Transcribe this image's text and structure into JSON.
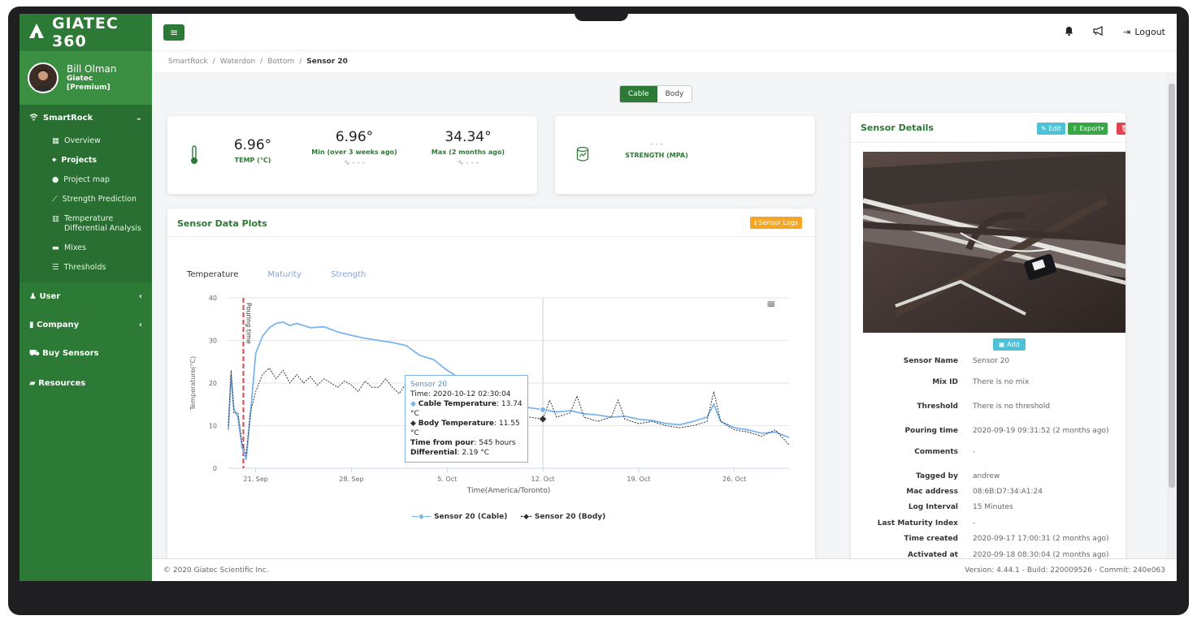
{
  "brand": {
    "name": "GIATEC 360"
  },
  "user": {
    "name": "Bill Olman",
    "company": "Giatec",
    "plan": "[Premium]"
  },
  "sidebar": {
    "group_title": "SmartRock",
    "items": [
      {
        "label": "Overview",
        "icon": "grid-icon"
      },
      {
        "label": "Projects",
        "icon": "sitemap-icon"
      },
      {
        "label": "Project map",
        "icon": "globe-icon"
      },
      {
        "label": "Strength Prediction",
        "icon": "line-chart-icon"
      },
      {
        "label": "Temperature Differential Analysis",
        "icon": "bar-chart-icon"
      },
      {
        "label": "Mixes",
        "icon": "truck-icon"
      },
      {
        "label": "Thresholds",
        "icon": "sliders-icon"
      }
    ],
    "links": [
      {
        "label": "User",
        "icon": "user-icon"
      },
      {
        "label": "Company",
        "icon": "building-icon"
      },
      {
        "label": "Buy Sensors",
        "icon": "cart-icon"
      },
      {
        "label": "Resources",
        "icon": "book-icon"
      }
    ]
  },
  "topbar": {
    "logout": "Logout"
  },
  "breadcrumb": [
    "SmartRock",
    "Waterdon",
    "Bottom",
    "Sensor 20"
  ],
  "toggle": {
    "cable": "Cable",
    "body": "Body"
  },
  "stats": {
    "temp": {
      "value": "6.96°",
      "label": "TEMP (°C)"
    },
    "min": {
      "value": "6.96°",
      "label": "Min (over 3 weeks ago)",
      "spark": "∿ - - -"
    },
    "max": {
      "value": "34.34°",
      "label": "Max (2 months ago)",
      "spark": "∿ - - -"
    },
    "strength": {
      "value": "- - -",
      "label": "STRENGTH (MPA)"
    }
  },
  "plots": {
    "title": "Sensor Data Plots",
    "logs_button": "Sensor Logs",
    "tabs": [
      "Temperature",
      "Maturity",
      "Strength"
    ],
    "pour_label": "Pouring time",
    "tooltip": {
      "title": "Sensor 20",
      "time_label": "Time",
      "time_value": "2020-10-12 02:30:04",
      "cable_label": "Cable Temperature",
      "cable_value": "13.74 °C",
      "body_label": "Body Temperature",
      "body_value": "11.55 °C",
      "pour_label": "Time from pour",
      "pour_value": "545 hours",
      "diff_label": "Differential",
      "diff_value": "2.19 °C"
    },
    "legend": {
      "cable": "Sensor 20 (Cable)",
      "body": "Sensor 20 (Body)"
    }
  },
  "chart_data": {
    "type": "line",
    "xlabel": "Time(America/Toronto)",
    "ylabel": "Temperature(°C)",
    "ylim": [
      0,
      40
    ],
    "yticks": [
      0,
      10,
      20,
      30,
      40
    ],
    "xticks": [
      "21. Sep",
      "28. Sep",
      "5. Oct",
      "12. Oct",
      "19. Oct",
      "26. Oct"
    ],
    "xtick_days": [
      2,
      9,
      16,
      23,
      30,
      37
    ],
    "xlim_days": [
      0,
      41
    ],
    "pour_day": 1.1,
    "crosshair_day": 23,
    "series": [
      {
        "name": "Sensor 20 (Cable)",
        "color": "#7cb5ec",
        "points": [
          [
            0,
            9
          ],
          [
            0.2,
            22
          ],
          [
            0.4,
            14
          ],
          [
            0.7,
            12
          ],
          [
            1,
            5
          ],
          [
            1.3,
            2
          ],
          [
            1.6,
            12
          ],
          [
            2,
            27
          ],
          [
            2.5,
            31
          ],
          [
            3,
            33
          ],
          [
            3.5,
            34
          ],
          [
            4,
            34.3
          ],
          [
            4.5,
            33.5
          ],
          [
            5,
            34
          ],
          [
            6,
            33
          ],
          [
            7,
            33.2
          ],
          [
            8,
            32
          ],
          [
            9,
            31.2
          ],
          [
            10,
            30.5
          ],
          [
            11,
            30
          ],
          [
            12,
            29.5
          ],
          [
            13,
            28.8
          ],
          [
            14,
            26.5
          ],
          [
            15,
            25.5
          ],
          [
            16,
            23
          ],
          [
            17,
            21
          ],
          [
            18,
            19.5
          ],
          [
            19,
            18
          ],
          [
            20,
            16.5
          ],
          [
            21,
            15
          ],
          [
            22,
            14.2
          ],
          [
            23,
            13.74
          ],
          [
            24,
            13.2
          ],
          [
            25,
            13.5
          ],
          [
            26,
            12.8
          ],
          [
            27,
            12.5
          ],
          [
            28,
            12
          ],
          [
            29,
            12.2
          ],
          [
            30,
            11.5
          ],
          [
            31,
            11.2
          ],
          [
            32,
            10.5
          ],
          [
            33,
            10.2
          ],
          [
            34,
            11
          ],
          [
            35,
            12
          ],
          [
            35.5,
            15
          ],
          [
            36,
            11
          ],
          [
            37,
            9.5
          ],
          [
            38,
            9
          ],
          [
            39,
            8.2
          ],
          [
            40,
            8.5
          ],
          [
            41,
            7.2
          ]
        ]
      },
      {
        "name": "Sensor 20 (Body)",
        "color": "#333333",
        "points": [
          [
            0,
            10
          ],
          [
            0.2,
            23
          ],
          [
            0.4,
            13
          ],
          [
            0.7,
            13
          ],
          [
            1,
            6
          ],
          [
            1.3,
            3
          ],
          [
            1.6,
            13
          ],
          [
            2,
            18
          ],
          [
            2.5,
            22
          ],
          [
            3,
            23.5
          ],
          [
            3.5,
            21
          ],
          [
            4,
            23
          ],
          [
            4.5,
            20
          ],
          [
            5,
            22
          ],
          [
            5.5,
            20
          ],
          [
            6,
            21.5
          ],
          [
            6.5,
            19.5
          ],
          [
            7,
            21
          ],
          [
            7.5,
            20
          ],
          [
            8,
            19
          ],
          [
            8.5,
            20.5
          ],
          [
            9,
            19.5
          ],
          [
            9.5,
            18
          ],
          [
            10,
            20.5
          ],
          [
            10.5,
            19
          ],
          [
            11,
            19
          ],
          [
            11.5,
            21
          ],
          [
            12,
            19
          ],
          [
            12.5,
            17.5
          ],
          [
            13,
            20
          ],
          [
            13.5,
            18
          ],
          [
            14,
            17
          ],
          [
            15,
            18.5
          ],
          [
            16,
            17
          ],
          [
            17,
            15.5
          ],
          [
            18,
            16
          ],
          [
            19,
            14
          ],
          [
            20,
            13.5
          ],
          [
            21,
            12.5
          ],
          [
            22,
            12
          ],
          [
            23,
            11.55
          ],
          [
            23.5,
            16
          ],
          [
            24,
            12
          ],
          [
            25,
            13
          ],
          [
            25.5,
            17
          ],
          [
            26,
            12
          ],
          [
            27,
            11
          ],
          [
            28,
            12
          ],
          [
            28.5,
            16
          ],
          [
            29,
            11.5
          ],
          [
            30,
            10.5
          ],
          [
            31,
            11
          ],
          [
            32,
            10
          ],
          [
            33,
            9.5
          ],
          [
            34,
            10
          ],
          [
            35,
            11
          ],
          [
            35.5,
            18
          ],
          [
            36,
            11
          ],
          [
            37,
            9
          ],
          [
            38,
            8.5
          ],
          [
            39,
            7.5
          ],
          [
            40,
            9
          ],
          [
            41,
            5.5
          ]
        ]
      }
    ]
  },
  "details": {
    "title": "Sensor Details",
    "buttons": {
      "edit": "Edit",
      "export": "Export▾",
      "delete": "Delete"
    },
    "add_button": "Add",
    "rows": [
      {
        "key": "Sensor Name",
        "value": "Sensor 20"
      },
      {
        "key": "Mix ID",
        "value": "There is no mix"
      },
      {
        "key": "Threshold",
        "value": "There is no threshold"
      },
      {
        "key": "Pouring time",
        "value": "2020-09-19 09:31:52 (2 months ago)"
      },
      {
        "key": "Comments",
        "value": "-"
      },
      {
        "key": "Tagged by",
        "value": "andrew"
      },
      {
        "key": "Mac address",
        "value": "08:6B:D7:34:A1:24"
      },
      {
        "key": "Log Interval",
        "value": "15 Minutes"
      },
      {
        "key": "Last Maturity Index",
        "value": "-"
      },
      {
        "key": "Time created",
        "value": "2020-09-17 17:00:31 (2 months ago)"
      },
      {
        "key": "Activated at",
        "value": "2020-09-18 08:30:04 (2 months ago)"
      }
    ]
  },
  "footer": {
    "copyright": "© 2020 Giatec Scientific Inc.",
    "version": "Version: 4.44.1 - Build: 220009526 - Commit: 240e063"
  }
}
